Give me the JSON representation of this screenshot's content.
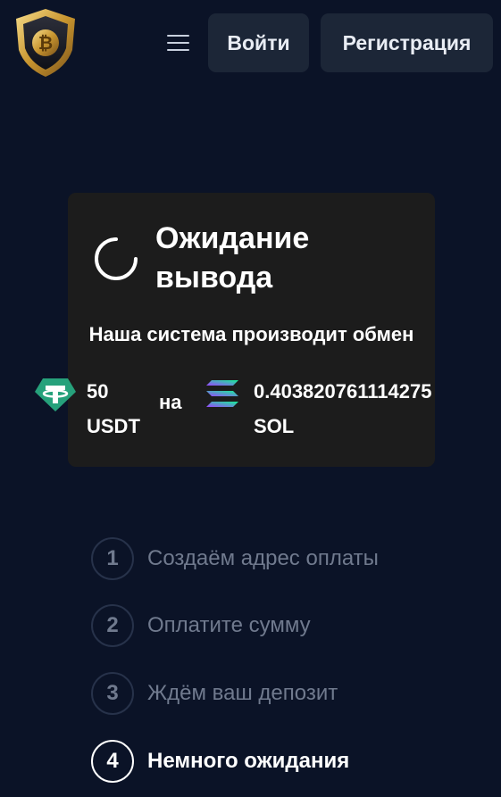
{
  "header": {
    "login_label": "Войти",
    "register_label": "Регистрация",
    "menu_icon": "hamburger-icon",
    "logo_icon": "bitcoin-shield-logo"
  },
  "status_card": {
    "title_line1": "Ожидание",
    "title_line2": "вывода",
    "subtitle": "Наша система производит обмен",
    "from": {
      "amount": "50",
      "currency": "USDT",
      "icon": "tether-icon"
    },
    "connector": "на",
    "to": {
      "amount": "0.403820761114275",
      "currency": "SOL",
      "icon": "solana-icon"
    }
  },
  "steps": [
    {
      "number": "1",
      "label": "Создаём адрес оплаты",
      "active": false
    },
    {
      "number": "2",
      "label": "Оплатите сумму",
      "active": false
    },
    {
      "number": "3",
      "label": "Ждём ваш депозит",
      "active": false
    },
    {
      "number": "4",
      "label": "Немного ожидания",
      "active": true
    }
  ],
  "colors": {
    "background": "#0b1327",
    "button_bg": "#1c2637",
    "card_bg": "#1c1c1c",
    "inactive_text": "#707a8e",
    "tether_green": "#26a17b"
  }
}
